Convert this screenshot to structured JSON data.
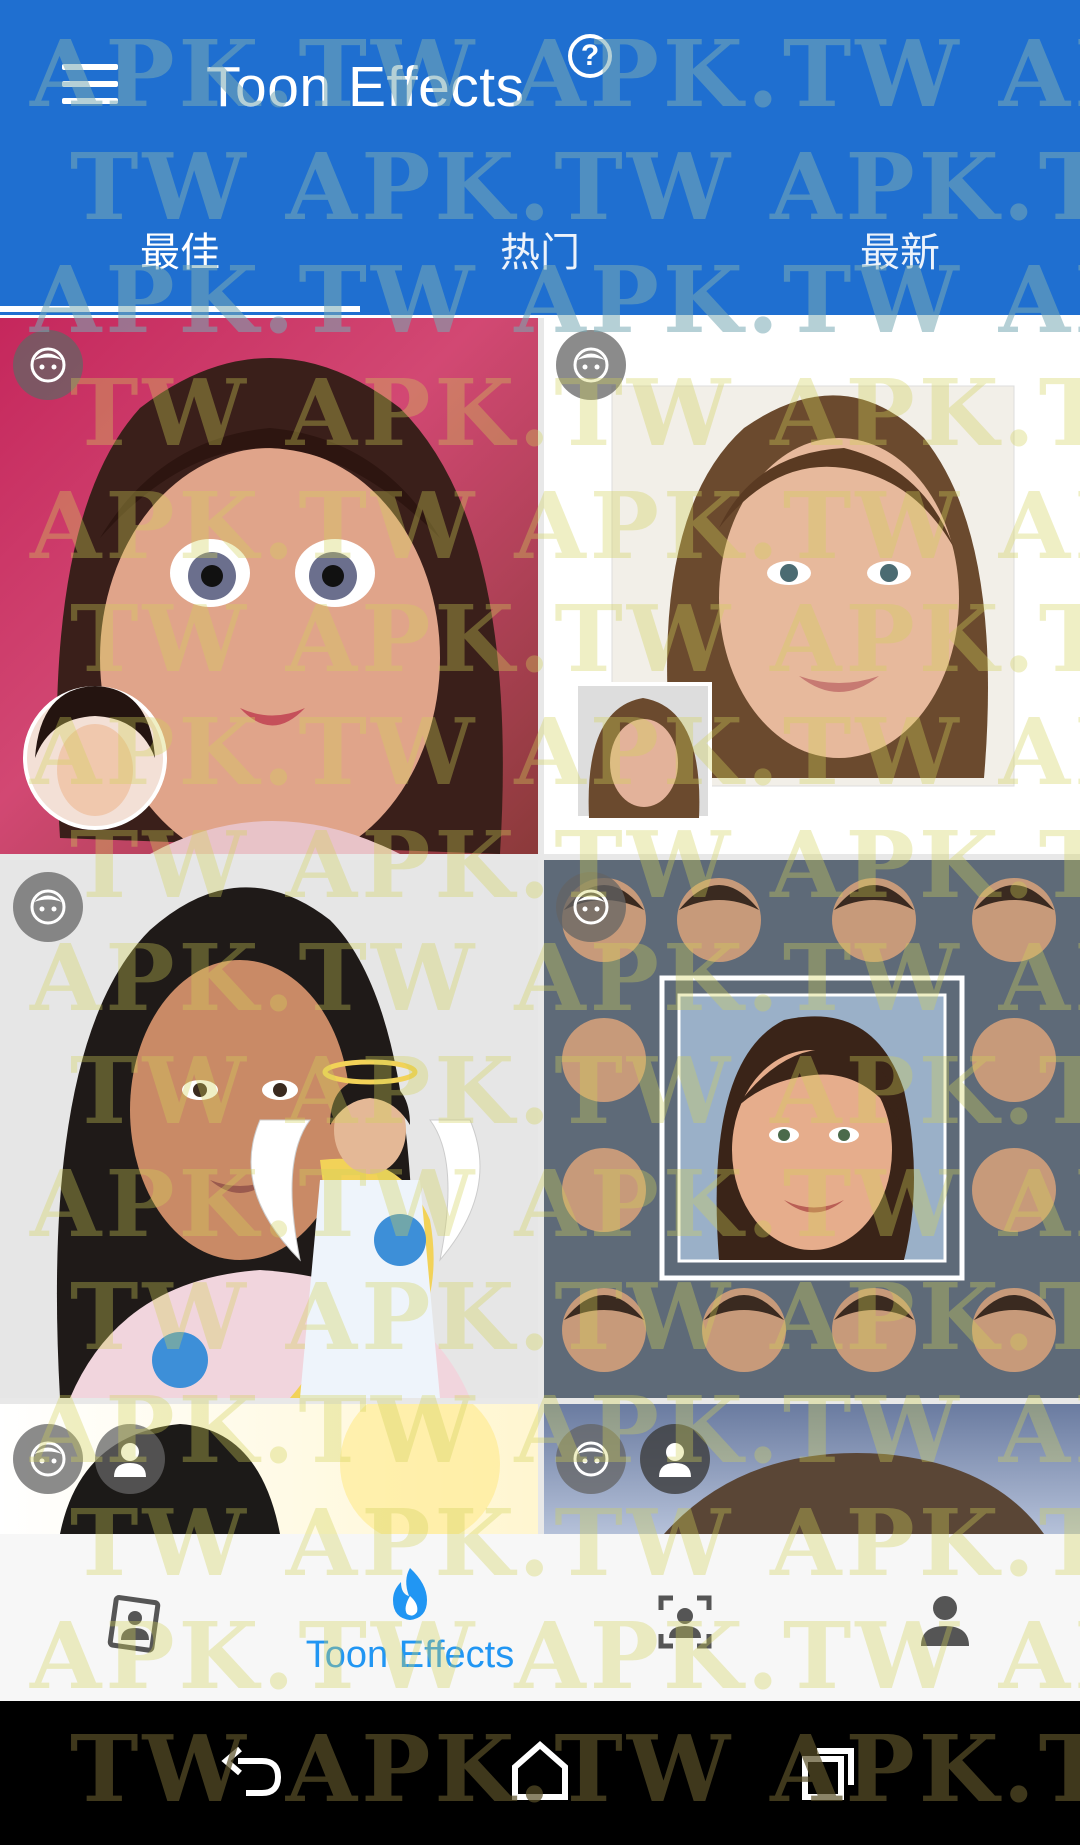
{
  "app": {
    "title": "Toon Effects",
    "help_icon": "help-circle-icon",
    "menu_icon": "hamburger-menu-icon"
  },
  "tabs": [
    {
      "label": "最佳",
      "active": true
    },
    {
      "label": "热门",
      "active": false
    },
    {
      "label": "最新",
      "active": false
    }
  ],
  "grid": {
    "cards": [
      {
        "name": "card-cartoon-girl",
        "badges": [
          "cartoon-face-icon"
        ]
      },
      {
        "name": "card-sketch-portrait",
        "badges": [
          "cartoon-face-icon"
        ]
      },
      {
        "name": "card-angel-sticker",
        "badges": [
          "cartoon-face-icon"
        ]
      },
      {
        "name": "card-celebrity-collage",
        "badges": [
          "cartoon-face-icon"
        ]
      },
      {
        "name": "card-partial-left",
        "badges": [
          "cartoon-face-icon",
          "person-icon"
        ]
      },
      {
        "name": "card-partial-right",
        "badges": [
          "cartoon-face-icon",
          "person-icon"
        ]
      }
    ]
  },
  "bottom_nav": {
    "items": [
      {
        "icon": "photo-portrait-icon",
        "label": ""
      },
      {
        "icon": "flame-icon",
        "label": "Toon Effects",
        "active": true
      },
      {
        "icon": "face-scan-icon",
        "label": ""
      },
      {
        "icon": "person-icon",
        "label": ""
      }
    ],
    "accent": "#2196f3"
  },
  "system_nav": {
    "back_icon": "back-arrow-icon",
    "home_icon": "home-icon",
    "recents_icon": "recents-icon"
  },
  "watermark": {
    "text_rows": [
      "APK.TW APK.TW APK.",
      "TW APK.TW APK.TW",
      "APK.TW APK.TW APK.",
      "TW APK.TW APK.TW",
      "APK.TW APK.TW APK.",
      "TW APK.TW APK.TW",
      "APK.TW APK.TW APK.",
      "TW APK.TW APK.TW",
      "APK.TW APK.TW APK.",
      "TW APK.TW APK.TW",
      "APK.TW APK.TW APK.",
      "TW APK.TW APK.TW",
      "APK.TW APK.TW APK.",
      "TW APK.TW APK.TW",
      "APK.TW APK.TW APK.",
      "TW APK.TW APK.TW"
    ]
  },
  "colors": {
    "header": "#1f6fd0",
    "nav_bg": "#f7f7f7",
    "accent": "#2196f3"
  }
}
